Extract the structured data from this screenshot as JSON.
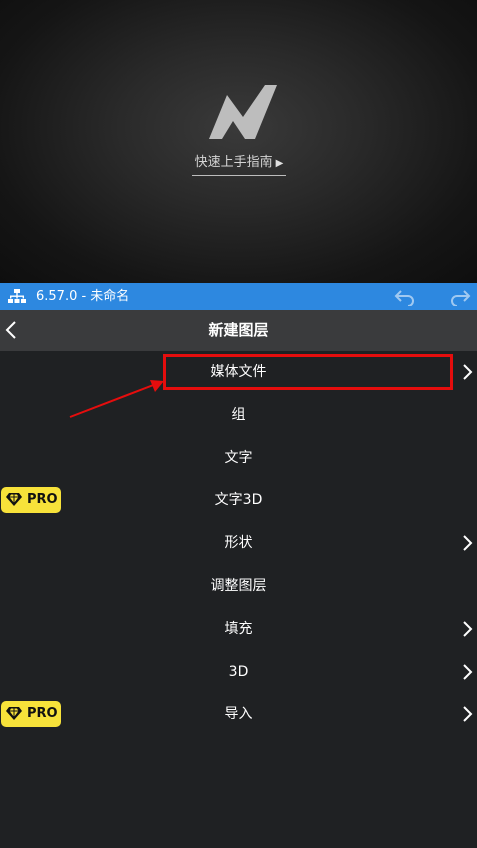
{
  "preview": {
    "guide_label": "快速上手指南",
    "guide_icon": "play-triangle-icon"
  },
  "topbar": {
    "title": "6.57.0 - 未命名",
    "background": "#2d88e0"
  },
  "header": {
    "title": "新建图层"
  },
  "menu": {
    "items": [
      {
        "label": "媒体文件",
        "has_submenu": true,
        "pro": false
      },
      {
        "label": "组",
        "has_submenu": false,
        "pro": false
      },
      {
        "label": "文字",
        "has_submenu": false,
        "pro": false
      },
      {
        "label": "文字3D",
        "has_submenu": false,
        "pro": true
      },
      {
        "label": "形状",
        "has_submenu": true,
        "pro": false
      },
      {
        "label": "调整图层",
        "has_submenu": false,
        "pro": false
      },
      {
        "label": "填充",
        "has_submenu": true,
        "pro": false
      },
      {
        "label": "3D",
        "has_submenu": true,
        "pro": false
      },
      {
        "label": "导入",
        "has_submenu": true,
        "pro": true
      }
    ],
    "pro_badge_label": "PRO",
    "pro_badge_color": "#f7e23a"
  },
  "annotation": {
    "highlight_color": "#e50d0d",
    "highlighted_item": "媒体文件"
  }
}
